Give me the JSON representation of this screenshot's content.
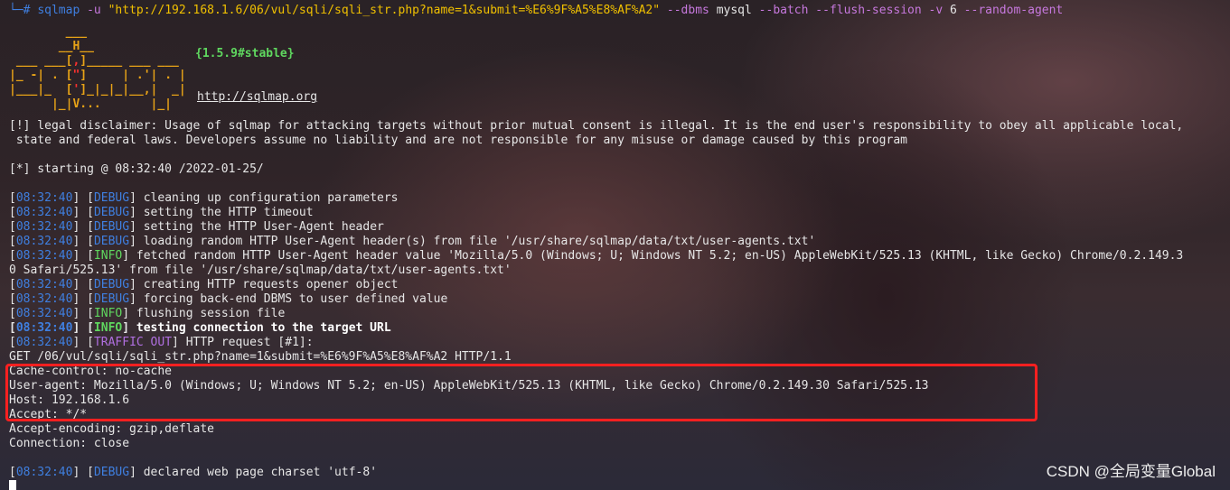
{
  "command": {
    "prompt": "└─# ",
    "binary": "sqlmap",
    "flag_u": "-u",
    "url": "\"http://192.168.1.6/06/vul/sqli/sqli_str.php?name=1&submit=%E6%9F%A5%E8%AF%A2\"",
    "flag_dbms": "--dbms",
    "dbms": "mysql",
    "flag_batch": "--batch",
    "flag_flush": "--flush-session",
    "flag_v": "-v",
    "v_level": "6",
    "flag_agent": "--random-agent"
  },
  "logo": {
    "version": "{1.5.9#stable}",
    "site": "http://sqlmap.org"
  },
  "disclaimer": {
    "line1": "[!] legal disclaimer: Usage of sqlmap for attacking targets without prior mutual consent is illegal. It is the end user's responsibility to obey all applicable local,",
    "line2": " state and federal laws. Developers assume no liability and are not responsible for any misuse or damage caused by this program"
  },
  "starting": "[*] starting @ 08:32:40 /2022-01-25/",
  "log": [
    {
      "time": "08:32:40",
      "level": "DEBUG",
      "msg": "cleaning up configuration parameters"
    },
    {
      "time": "08:32:40",
      "level": "DEBUG",
      "msg": "setting the HTTP timeout"
    },
    {
      "time": "08:32:40",
      "level": "DEBUG",
      "msg": "setting the HTTP User-Agent header"
    },
    {
      "time": "08:32:40",
      "level": "DEBUG",
      "msg": "loading random HTTP User-Agent header(s) from file '/usr/share/sqlmap/data/txt/user-agents.txt'"
    },
    {
      "time": "08:32:40",
      "level": "INFO",
      "msg": "fetched random HTTP User-Agent header value 'Mozilla/5.0 (Windows; U; Windows NT 5.2; en-US) AppleWebKit/525.13 (KHTML, like Gecko) Chrome/0.2.149.3"
    },
    {
      "time": "",
      "level": "",
      "msg": "0 Safari/525.13' from file '/usr/share/sqlmap/data/txt/user-agents.txt'"
    },
    {
      "time": "08:32:40",
      "level": "DEBUG",
      "msg": "creating HTTP requests opener object"
    },
    {
      "time": "08:32:40",
      "level": "DEBUG",
      "msg": "forcing back-end DBMS to user defined value"
    },
    {
      "time": "08:32:40",
      "level": "INFO",
      "msg": "flushing session file"
    },
    {
      "time": "08:32:40",
      "level": "INFO",
      "msg": "testing connection to the target URL"
    },
    {
      "time": "08:32:40",
      "level": "TRAFFIC OUT",
      "msg": "HTTP request [#1]:"
    }
  ],
  "request": {
    "request_line": "GET /06/vul/sqli/sqli_str.php?name=1&submit=%E6%9F%A5%E8%AF%A2 HTTP/1.1",
    "cache_control": "Cache-control: no-cache",
    "user_agent": "User-agent: Mozilla/5.0 (Windows; U; Windows NT 5.2; en-US) AppleWebKit/525.13 (KHTML, like Gecko) Chrome/0.2.149.30 Safari/525.13",
    "host": "Host: 192.168.1.6",
    "accept": "Accept: */*",
    "accept_encoding": "Accept-encoding: gzip,deflate",
    "connection": "Connection: close"
  },
  "last_log": {
    "time": "08:32:40",
    "level": "DEBUG",
    "msg": "declared web page charset 'utf-8'"
  },
  "watermark": "CSDN @全局变量Global",
  "colors": {
    "timestamp": "#3f7fe0",
    "debug": "#3f7fe0",
    "info": "#5fd75f",
    "traffic_out": "#b06fe0",
    "highlight_box": "#ff2020",
    "logo": "#e8a317"
  }
}
